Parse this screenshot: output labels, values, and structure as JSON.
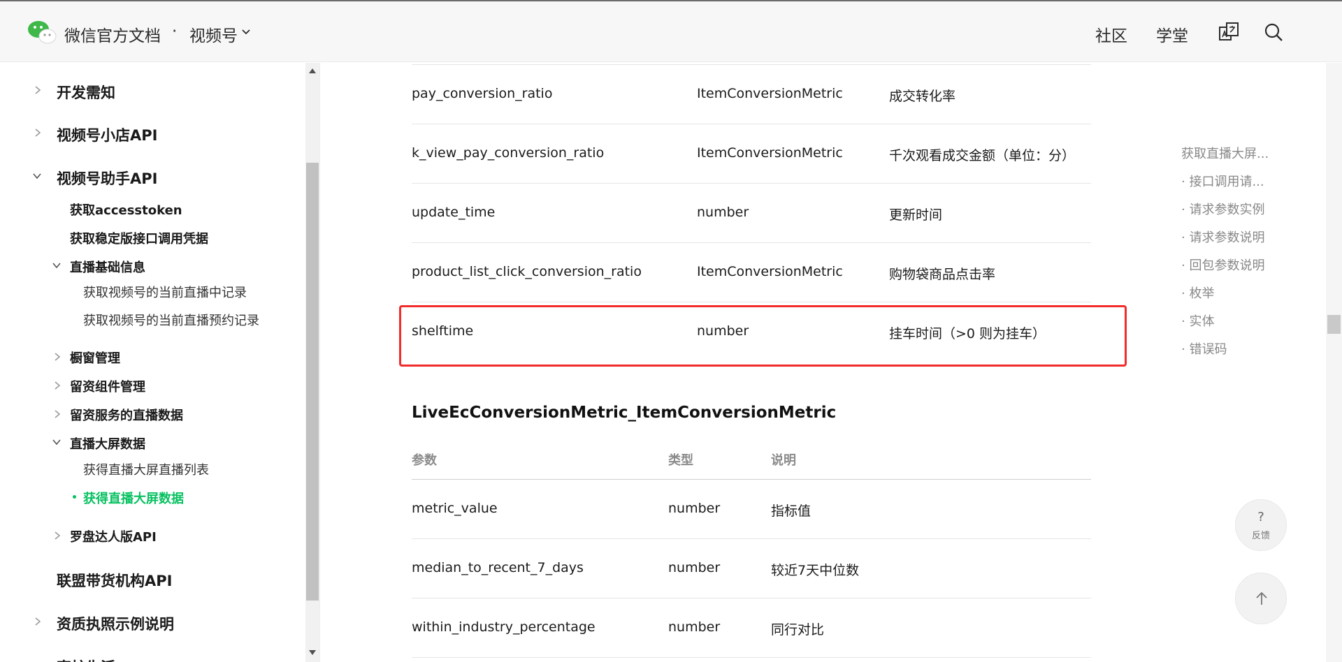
{
  "header": {
    "brand": "微信官方文档",
    "separator": "·",
    "product": "视频号",
    "nav": [
      "社区",
      "学堂"
    ],
    "icons": [
      "translate-icon",
      "search-icon"
    ]
  },
  "sidebar": {
    "items": [
      {
        "label": "开发需知"
      },
      {
        "label": "视频号小店API"
      },
      {
        "label": "视频号助手API"
      },
      {
        "label": "获取accesstoken"
      },
      {
        "label": "获取稳定版接口调用凭据"
      },
      {
        "label": "直播基础信息"
      },
      {
        "label": "获取视频号的当前直播中记录"
      },
      {
        "label": "获取视频号的当前直播预约记录"
      },
      {
        "label": "橱窗管理"
      },
      {
        "label": "留资组件管理"
      },
      {
        "label": "留资服务的直播数据"
      },
      {
        "label": "直播大屏数据"
      },
      {
        "label": "获得直播大屏直播列表"
      },
      {
        "label": "获得直播大屏数据"
      },
      {
        "label": "罗盘达人版API"
      },
      {
        "label": "联盟带货机构API"
      },
      {
        "label": "资质执照示例说明"
      },
      {
        "label": "直桩生活"
      }
    ],
    "active_color": "#07c160"
  },
  "table1": {
    "rows": [
      {
        "param": "pay_conversion_ratio",
        "type": "ItemConversionMetric",
        "desc": "成交转化率"
      },
      {
        "param": "k_view_pay_conversion_ratio",
        "type": "ItemConversionMetric",
        "desc": "千次观看成交金额（单位：分）"
      },
      {
        "param": "update_time",
        "type": "number",
        "desc": "更新时间"
      },
      {
        "param": "product_list_click_conversion_ratio",
        "type": "ItemConversionMetric",
        "desc": "购物袋商品点击率"
      },
      {
        "param": "shelftime",
        "type": "number",
        "desc": "挂车时间（>0 则为挂车）"
      }
    ]
  },
  "section2": {
    "title": "LiveEcConversionMetric_ItemConversionMetric",
    "headers": [
      "参数",
      "类型",
      "说明"
    ],
    "rows": [
      {
        "param": "metric_value",
        "type": "number",
        "desc": "指标值"
      },
      {
        "param": "median_to_recent_7_days",
        "type": "number",
        "desc": "较近7天中位数"
      },
      {
        "param": "within_industry_percentage",
        "type": "number",
        "desc": "同行对比"
      }
    ]
  },
  "toc": {
    "items": [
      "获取直播大屏...",
      "· 接口调用请...",
      "· 请求参数实例",
      "· 请求参数说明",
      "· 回包参数说明",
      "· 枚举",
      "· 实体",
      "· 错误码"
    ]
  },
  "float": {
    "feedback_q": "?",
    "feedback_label": "反馈"
  },
  "colors": {
    "highlight": "#f22b2b",
    "accent": "#07c160"
  }
}
